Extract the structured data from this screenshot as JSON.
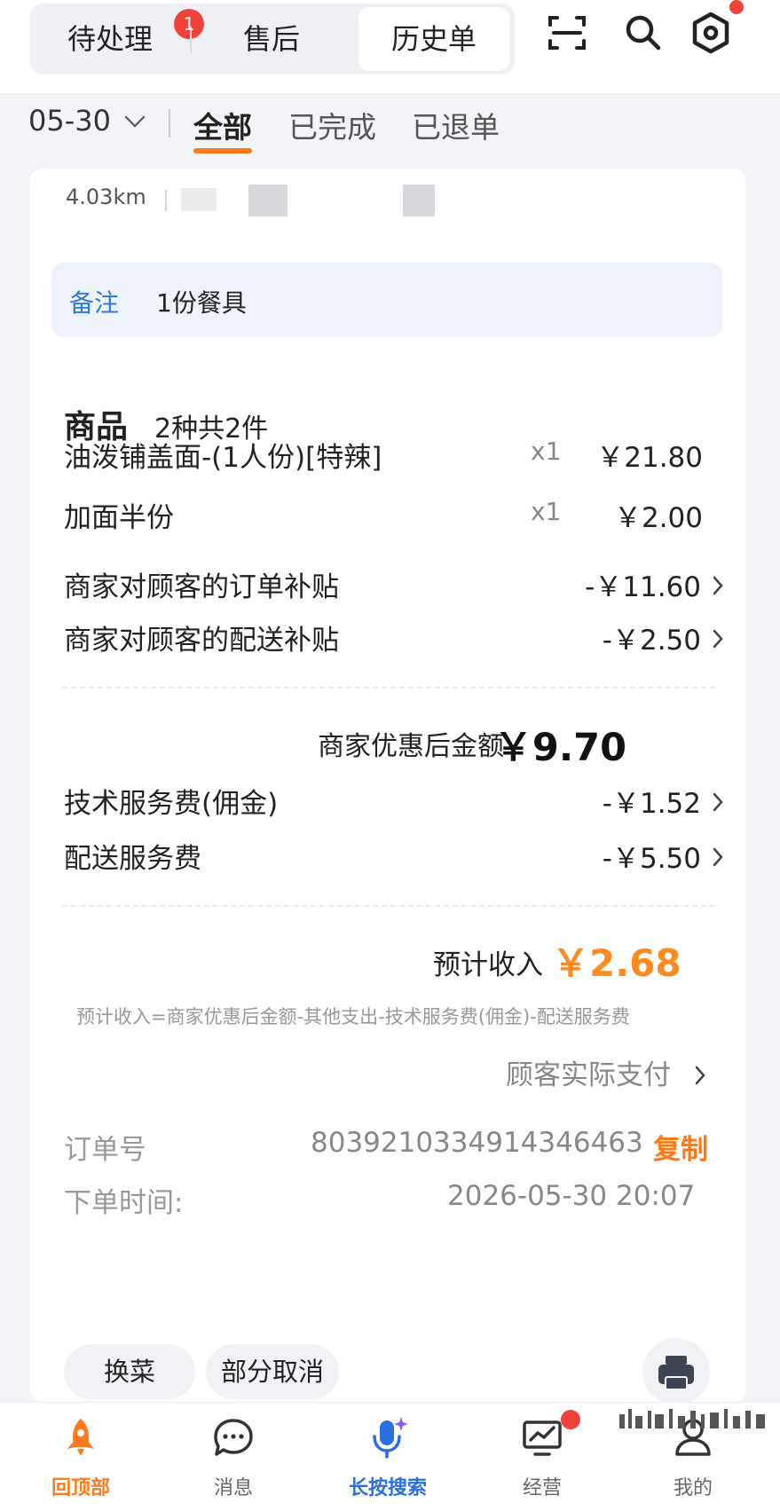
{
  "top_tabs": {
    "pending": "待处理",
    "pending_badge": "1",
    "after_sales": "售后",
    "history": "历史单"
  },
  "icons": {
    "scan": "scan-icon",
    "search": "search-icon",
    "settings": "settings-hex-icon"
  },
  "filter": {
    "date": "05-30",
    "tabs": [
      "全部",
      "已完成",
      "已退单"
    ],
    "active_tab": "全部"
  },
  "order": {
    "distance": "4.03km",
    "note_label": "备注",
    "note_text": "1份餐具",
    "goods_title": "商品",
    "goods_summary": "2种共2件",
    "items": [
      {
        "name": "油泼铺盖面-(1人份)[特辣]",
        "qty": "x1",
        "price": "￥21.80"
      },
      {
        "name": "加面半份",
        "qty": "x1",
        "price": "￥2.00"
      }
    ],
    "subsidies": [
      {
        "name": "商家对顾客的订单补贴",
        "amount": "-￥11.60"
      },
      {
        "name": "商家对顾客的配送补贴",
        "amount": "-￥2.50"
      }
    ],
    "after_discount_label": "商家优惠后金额",
    "after_discount_amount": "￥9.70",
    "fees": [
      {
        "name": "技术服务费(佣金)",
        "amount": "-￥1.52"
      },
      {
        "name": "配送服务费",
        "amount": "-￥5.50"
      }
    ],
    "income_label": "预计收入",
    "income_amount": "￥2.68",
    "formula": "预计收入=商家优惠后金额-其他支出-技术服务费(佣金)-配送服务费",
    "actual_payment": "顾客实际支付",
    "order_no_label": "订单号",
    "order_no": "8039210334914346463",
    "copy_label": "复制",
    "order_time_label": "下单时间:",
    "order_time": "2026-05-30 20:07",
    "actions": [
      "换菜",
      "部分取消"
    ]
  },
  "bottom_nav": [
    {
      "label": "回顶部",
      "icon": "rocket-icon",
      "state": "active"
    },
    {
      "label": "消息",
      "icon": "chat-bubble-icon",
      "state": "normal"
    },
    {
      "label": "长按搜索",
      "icon": "mic-sparkle-icon",
      "state": "highlight"
    },
    {
      "label": "经营",
      "icon": "chart-monitor-icon",
      "state": "normal"
    },
    {
      "label": "我的",
      "icon": "user-icon",
      "state": "normal"
    }
  ],
  "colors": {
    "accent": "#ff7a1a",
    "income": "#ff8a1f",
    "badge_red": "#f0413a",
    "note_blue": "#2f7ae0",
    "search_blue": "#2c6fe0",
    "background": "#f3f4f8"
  }
}
